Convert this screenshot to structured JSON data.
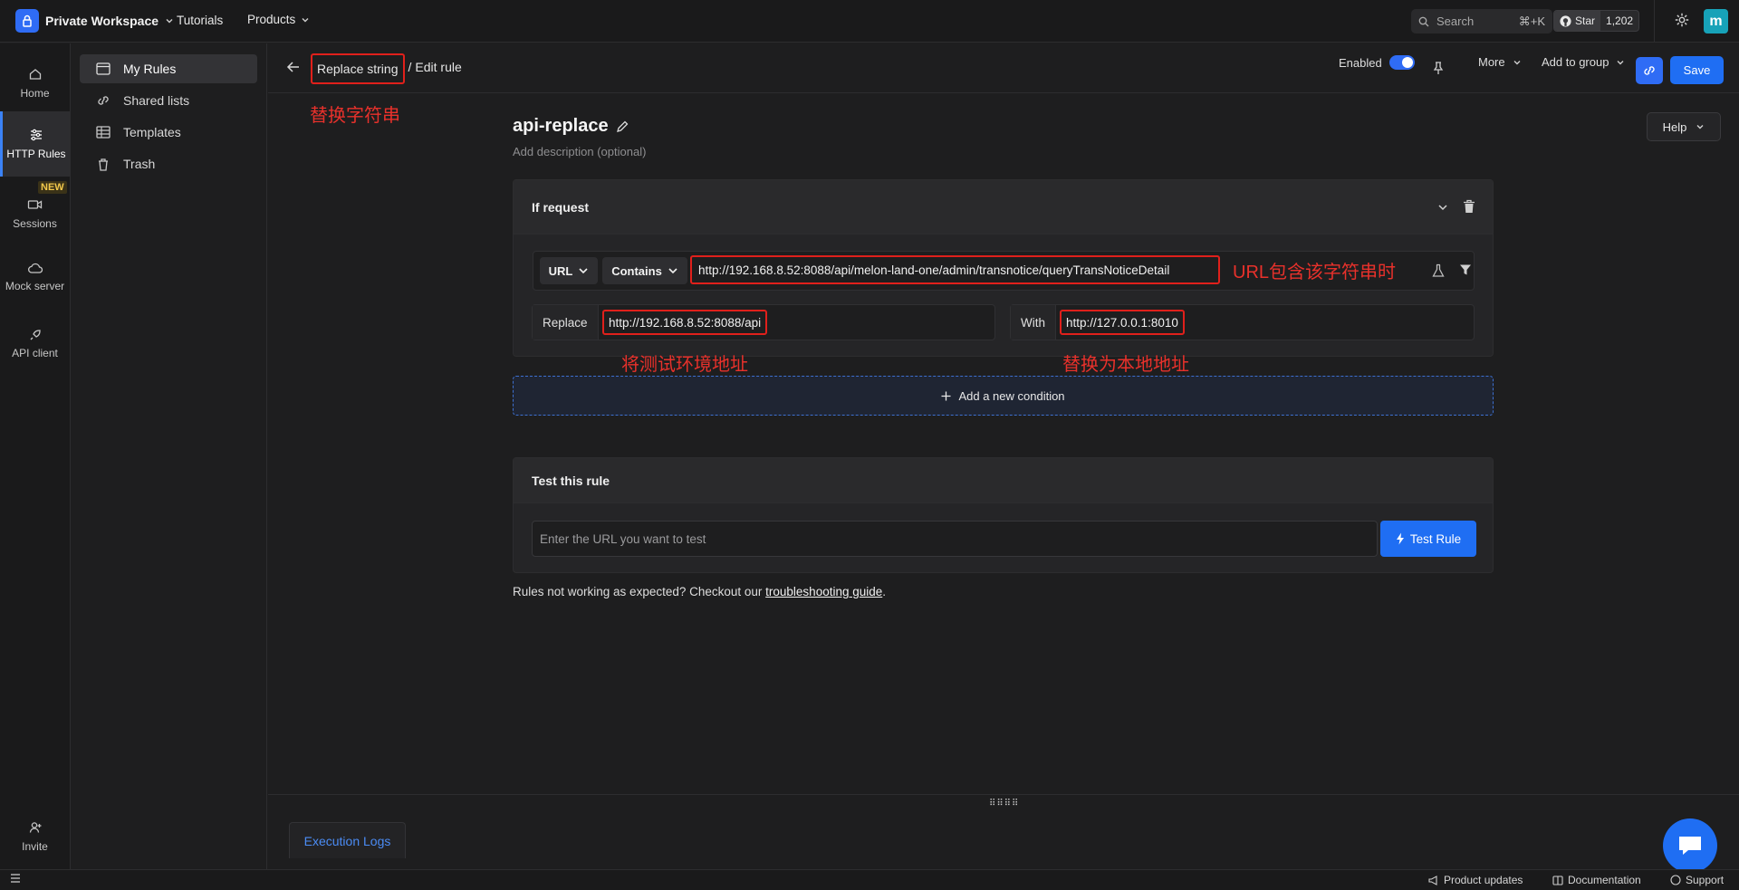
{
  "topbar": {
    "workspace": "Private Workspace",
    "tutorials": "Tutorials",
    "products": "Products",
    "search_label": "Search",
    "search_shortcut": "⌘+K",
    "github_star": "Star",
    "github_count": "1,202",
    "avatar_letter": "m"
  },
  "rail": {
    "items": [
      {
        "label": "Home"
      },
      {
        "label": "HTTP Rules"
      },
      {
        "label": "Sessions"
      },
      {
        "label": "Mock server"
      },
      {
        "label": "API client"
      }
    ],
    "new_badge": "NEW",
    "invite": "Invite"
  },
  "sidebar": {
    "items": [
      {
        "label": "My Rules"
      },
      {
        "label": "Shared lists"
      },
      {
        "label": "Templates"
      },
      {
        "label": "Trash"
      }
    ]
  },
  "header": {
    "crumb_type": "Replace string",
    "crumb_sep": "/",
    "crumb_page": "Edit rule",
    "enabled_label": "Enabled",
    "enabled": true,
    "more": "More",
    "add_to_group": "Add to group",
    "save": "Save"
  },
  "annotations": {
    "replace_string": "替换字符串",
    "url_contains": "URL包含该字符串时",
    "test_env": "将测试环境地址",
    "local_addr": "替换为本地地址"
  },
  "rule": {
    "name": "api-replace",
    "description_placeholder": "Add description (optional)",
    "help": "Help"
  },
  "if_request": {
    "title": "If request",
    "source": "URL",
    "operator": "Contains",
    "value": "http://192.168.8.52:8088/api/melon-land-one/admin/transnotice/queryTransNoticeDetail",
    "replace_label": "Replace",
    "replace_value": "http://192.168.8.52:8088/api",
    "with_label": "With",
    "with_value": "http://127.0.0.1:8010"
  },
  "add_condition": "Add a new condition",
  "test": {
    "title": "Test this rule",
    "placeholder": "Enter the URL you want to test",
    "button": "Test Rule"
  },
  "troubleshoot": {
    "prefix": "Rules not working as expected? Checkout our ",
    "link": "troubleshooting guide",
    "suffix": "."
  },
  "logs": {
    "tab": "Execution Logs"
  },
  "statusbar": {
    "product_updates": "Product updates",
    "documentation": "Documentation",
    "support": "Support"
  },
  "colors": {
    "accent": "#1f6ef3",
    "annotation": "#e0201b",
    "background": "#1e1e1f"
  }
}
